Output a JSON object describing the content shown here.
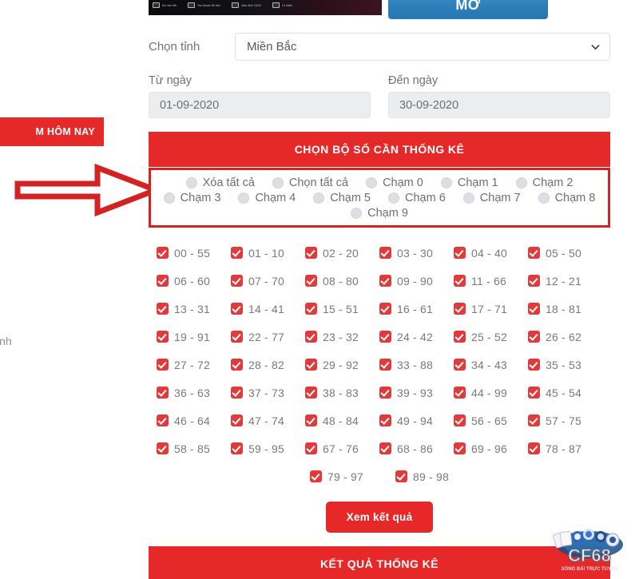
{
  "left_overlay": {
    "banner_text": "M HÔM NAY",
    "text_fragment": "inh",
    "arrow_icon": "right-arrow-annotation"
  },
  "promo": {
    "items": [
      {
        "icon": "screen-icon",
        "label": "Soi cầu Mb"
      },
      {
        "icon": "wallet-icon",
        "label": "Tạo khoản đề tiền"
      },
      {
        "icon": "phone-icon",
        "label": "Giao dịch 24/24"
      },
      {
        "icon": "chart-icon",
        "label": "Lô bảnh"
      }
    ],
    "open_button": "MỞ"
  },
  "form": {
    "province_label": "Chọn tỉnh",
    "province_value": "Miền Bắc",
    "province_icon": "chevron-down-icon",
    "from_label": "Từ ngày",
    "from_value": "01-09-2020",
    "to_label": "Đến ngày",
    "to_value": "30-09-2020"
  },
  "sections": {
    "choose_header": "CHỌN BỘ SỐ CẦN THỐNG KÊ",
    "result_header": "KẾT QUẢ THỐNG KÊ"
  },
  "radio_rows": [
    [
      "Xóa tất cả",
      "Chọn tất cả",
      "Chạm 0",
      "Chạm 1",
      "Chạm 2"
    ],
    [
      "Chạm 3",
      "Chạm 4",
      "Chạm 5",
      "Chạm 6",
      "Chạm 7",
      "Chạm 8"
    ],
    [
      "Chạm 9"
    ]
  ],
  "number_rows": [
    [
      "00 - 55",
      "01 - 10",
      "02 - 20",
      "03 - 30",
      "04 - 40",
      "05 - 50"
    ],
    [
      "06 - 60",
      "07 - 70",
      "08 - 80",
      "09 - 90",
      "11 - 66",
      "12 - 21"
    ],
    [
      "13 - 31",
      "14 - 41",
      "15 - 51",
      "16 - 61",
      "17 - 71",
      "18 - 81"
    ],
    [
      "19 - 91",
      "22 - 77",
      "23 - 32",
      "24 - 42",
      "25 - 52",
      "26 - 62"
    ],
    [
      "27 - 72",
      "28 - 82",
      "29 - 92",
      "33 - 88",
      "34 - 43",
      "35 - 53"
    ],
    [
      "36 - 63",
      "37 - 73",
      "38 - 83",
      "39 - 93",
      "44 - 99",
      "45 - 54"
    ],
    [
      "46 - 64",
      "47 - 74",
      "48 - 84",
      "49 - 94",
      "56 - 65",
      "57 - 75"
    ],
    [
      "58 - 85",
      "59 - 95",
      "67 - 76",
      "68 - 86",
      "69 - 96",
      "78 - 87"
    ],
    [
      "79 - 97",
      "89 - 98"
    ]
  ],
  "actions": {
    "view_result": "Xem kết quả"
  },
  "watermark": {
    "brand": "CF68",
    "tagline": "SÒNG BÀI TRỰC TUYẾN"
  },
  "colors": {
    "red": "#e62828",
    "annotation_red": "#d32222",
    "checkbox_red": "#e23a3a",
    "blue": "#2e80bb",
    "text_gray": "#6c6f73"
  }
}
